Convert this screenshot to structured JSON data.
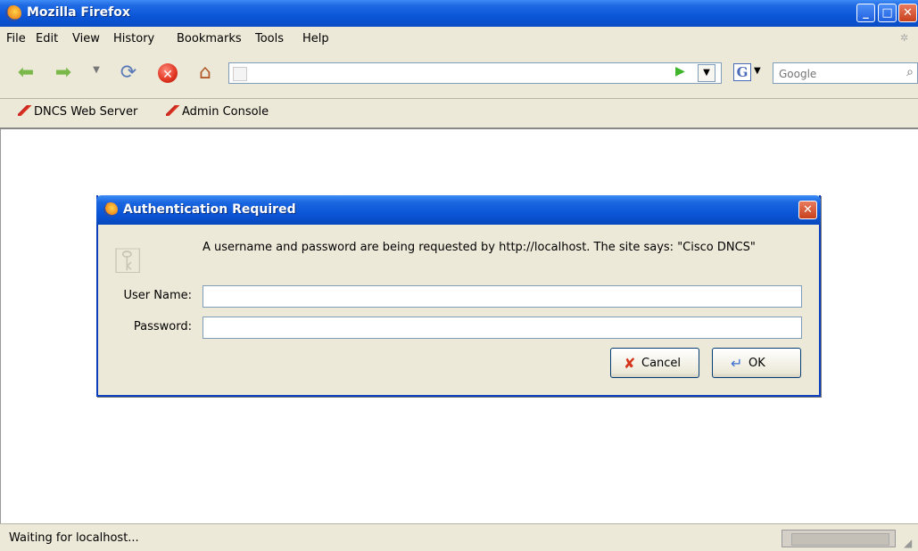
{
  "window": {
    "title": "Mozilla Firefox"
  },
  "menu": [
    "File",
    "Edit",
    "View",
    "History",
    "Bookmarks",
    "Tools",
    "Help"
  ],
  "toolbar": {
    "url_value": "",
    "search_engine": "G",
    "search_placeholder": "Google"
  },
  "bookmarks": [
    "DNCS Web Server",
    "Admin Console"
  ],
  "dialog": {
    "title": "Authentication Required",
    "message": "A username and password are being requested by http://localhost. The site says: \"Cisco DNCS\"",
    "username_label": "User Name:",
    "username_value": "",
    "password_label": "Password:",
    "password_value": "",
    "cancel_label": "Cancel",
    "ok_label": "OK"
  },
  "status": {
    "text": "Waiting for localhost..."
  }
}
